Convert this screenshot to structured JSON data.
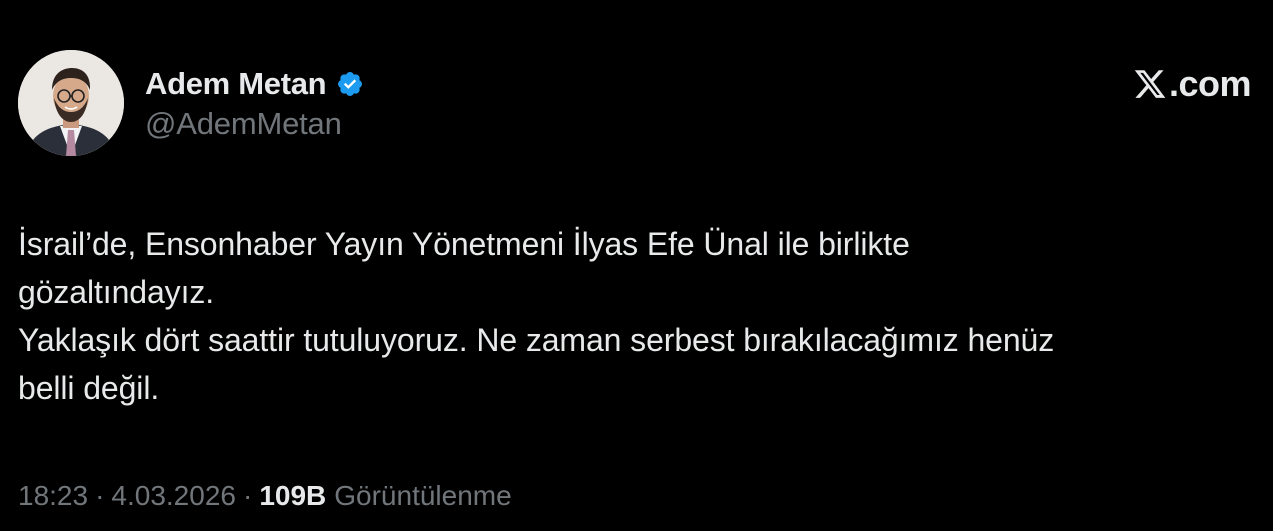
{
  "author": {
    "name": "Adem Metan",
    "handle": "@AdemMetan",
    "verified": true,
    "verified_color": "#1d9bf0"
  },
  "brand": {
    "label": ".com",
    "icon": "x-logo-icon"
  },
  "tweet": {
    "text": "İsrail’de, Ensonhaber Yayın Yönetmeni İlyas Efe Ünal ile birlikte\ngözaltındayız.\nYaklaşık dört saattir tutuluyoruz. Ne zaman serbest bırakılacağımız henüz\nbelli değil."
  },
  "meta": {
    "time": "18:23",
    "separator": "·",
    "date": "4.03.2026",
    "views_count": "109B",
    "views_label": "Görüntülenme"
  },
  "colors": {
    "background": "#000000",
    "text_primary": "#e7e9ea",
    "text_secondary": "#71767b"
  }
}
